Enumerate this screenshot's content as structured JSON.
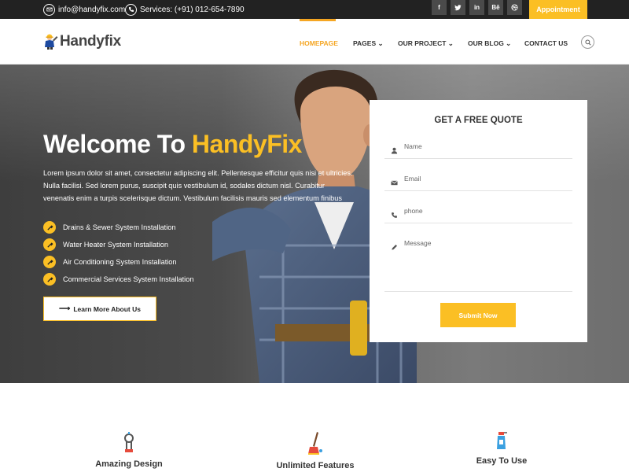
{
  "topbar": {
    "email": "info@handyfix.com",
    "phone": "Services: (+91) 012-654-7890",
    "socials": [
      {
        "icon": "facebook-icon",
        "glyph": "f"
      },
      {
        "icon": "twitter-icon",
        "glyph": "🐦"
      },
      {
        "icon": "linkedin-icon",
        "glyph": "in"
      },
      {
        "icon": "behance-icon",
        "glyph": "Bē"
      },
      {
        "icon": "dribbble-icon",
        "glyph": "◎"
      }
    ],
    "appointment_label": "Appointment"
  },
  "nav": {
    "logo_text": "Handyfix",
    "items": [
      {
        "label": "HOMEPAGE",
        "active": true
      },
      {
        "label": "PAGES ⌄"
      },
      {
        "label": "OUR PROJECT ⌄"
      },
      {
        "label": "OUR BLOG ⌄"
      },
      {
        "label": "CONTACT US"
      }
    ]
  },
  "hero": {
    "title_prefix": "Welcome To ",
    "title_highlight": "HandyFix",
    "lead": "Lorem ipsum dolor sit amet, consectetur adipiscing elit. Pellentesque efficitur quis nisi et ultricies. Nulla facilisi. Sed lorem purus, suscipit quis vestibulum id, sodales dictum nisl. Curabitur venenatis enim a turpis scelerisque dictum. Vestibulum facilisis mauris sed elementum finibus",
    "checklist": [
      "Drains & Sewer System Installation",
      "Water Heater System Installation",
      "Air Conditioning System Installation",
      "Commercial Services System Installation"
    ],
    "cta_label": "Learn More About Us"
  },
  "quote": {
    "title": "GET A FREE QUOTE",
    "name_placeholder": "Name",
    "email_placeholder": "Email",
    "phone_placeholder": "phone",
    "message_placeholder": "Message",
    "submit_label": "Submit Now"
  },
  "features": [
    {
      "title": "Amazing Design"
    },
    {
      "title": "Unlimited Features"
    },
    {
      "title": "Easy To Use"
    }
  ],
  "colors": {
    "accent": "#fbbf24",
    "topbar": "#222222",
    "nav_active": "#f5a623"
  }
}
